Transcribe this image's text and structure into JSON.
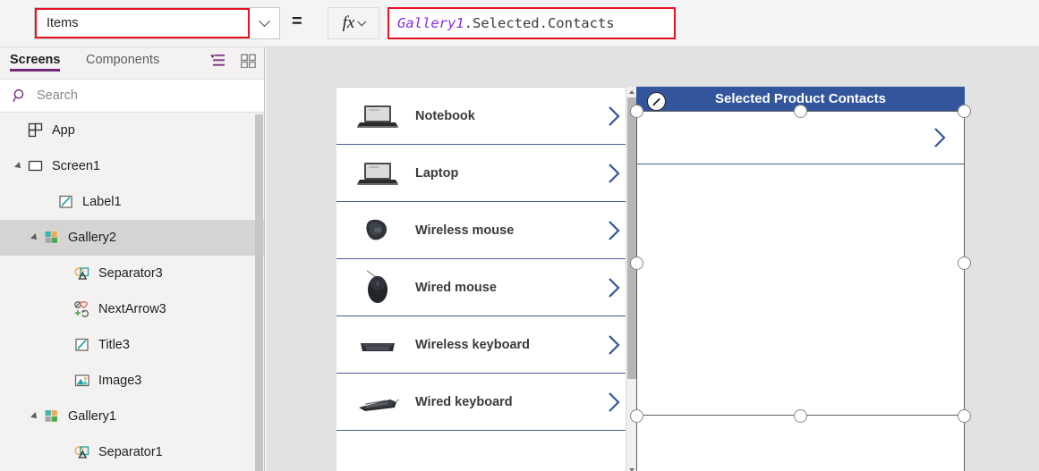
{
  "formula_bar": {
    "property_value": "Items",
    "equals": "=",
    "fx_label": "fx",
    "formula_ref": "Gallery1",
    "formula_rest": ".Selected.Contacts",
    "accent_red": "#e81123",
    "ref_color": "#8a2be2"
  },
  "left_panel": {
    "tabs": [
      {
        "label": "Screens",
        "active": true
      },
      {
        "label": "Components",
        "active": false
      }
    ],
    "view_icons": [
      {
        "name": "tree-view-icon",
        "color": "#742774"
      },
      {
        "name": "grid-view-icon",
        "color": "#8a8886"
      }
    ],
    "search": {
      "placeholder": "Search",
      "icon": "search-icon"
    },
    "tree": [
      {
        "label": "App",
        "icon": "app-icon",
        "indent": 18,
        "twisty": "none",
        "selected": false
      },
      {
        "label": "Screen1",
        "icon": "screen-icon",
        "indent": 18,
        "twisty": "expanded",
        "selected": false
      },
      {
        "label": "Label1",
        "icon": "label-icon",
        "indent": 52,
        "twisty": "none",
        "selected": false
      },
      {
        "label": "Gallery2",
        "icon": "gallery-icon",
        "indent": 36,
        "twisty": "expanded",
        "selected": true
      },
      {
        "label": "Separator3",
        "icon": "separator-icon",
        "indent": 70,
        "twisty": "none",
        "selected": false
      },
      {
        "label": "NextArrow3",
        "icon": "nextarrow-icon",
        "indent": 70,
        "twisty": "none",
        "selected": false
      },
      {
        "label": "Title3",
        "icon": "label-icon",
        "indent": 70,
        "twisty": "none",
        "selected": false
      },
      {
        "label": "Image3",
        "icon": "image-icon",
        "indent": 70,
        "twisty": "none",
        "selected": false
      },
      {
        "label": "Gallery1",
        "icon": "gallery-icon",
        "indent": 36,
        "twisty": "expanded",
        "selected": false
      },
      {
        "label": "Separator1",
        "icon": "separator-icon",
        "indent": 70,
        "twisty": "none",
        "selected": false
      }
    ]
  },
  "canvas": {
    "background": "#e2e2e2",
    "gallery1": {
      "name": "Gallery1",
      "items": [
        {
          "title": "Notebook",
          "image": "laptop-photo"
        },
        {
          "title": "Laptop",
          "image": "laptop-photo"
        },
        {
          "title": "Wireless mouse",
          "image": "wireless-mouse-photo"
        },
        {
          "title": "Wired mouse",
          "image": "wired-mouse-photo"
        },
        {
          "title": "Wireless keyboard",
          "image": "wireless-keyboard-photo"
        },
        {
          "title": "Wired keyboard",
          "image": "wired-keyboard-photo"
        }
      ],
      "separator_color": "#4b5b8f",
      "arrow_color": "#32559b"
    },
    "gallery2": {
      "name": "Gallery2",
      "header_title": "Selected Product Contacts",
      "header_background": "#32559b",
      "header_text_color": "#ffffff",
      "selected": true,
      "items": []
    }
  }
}
